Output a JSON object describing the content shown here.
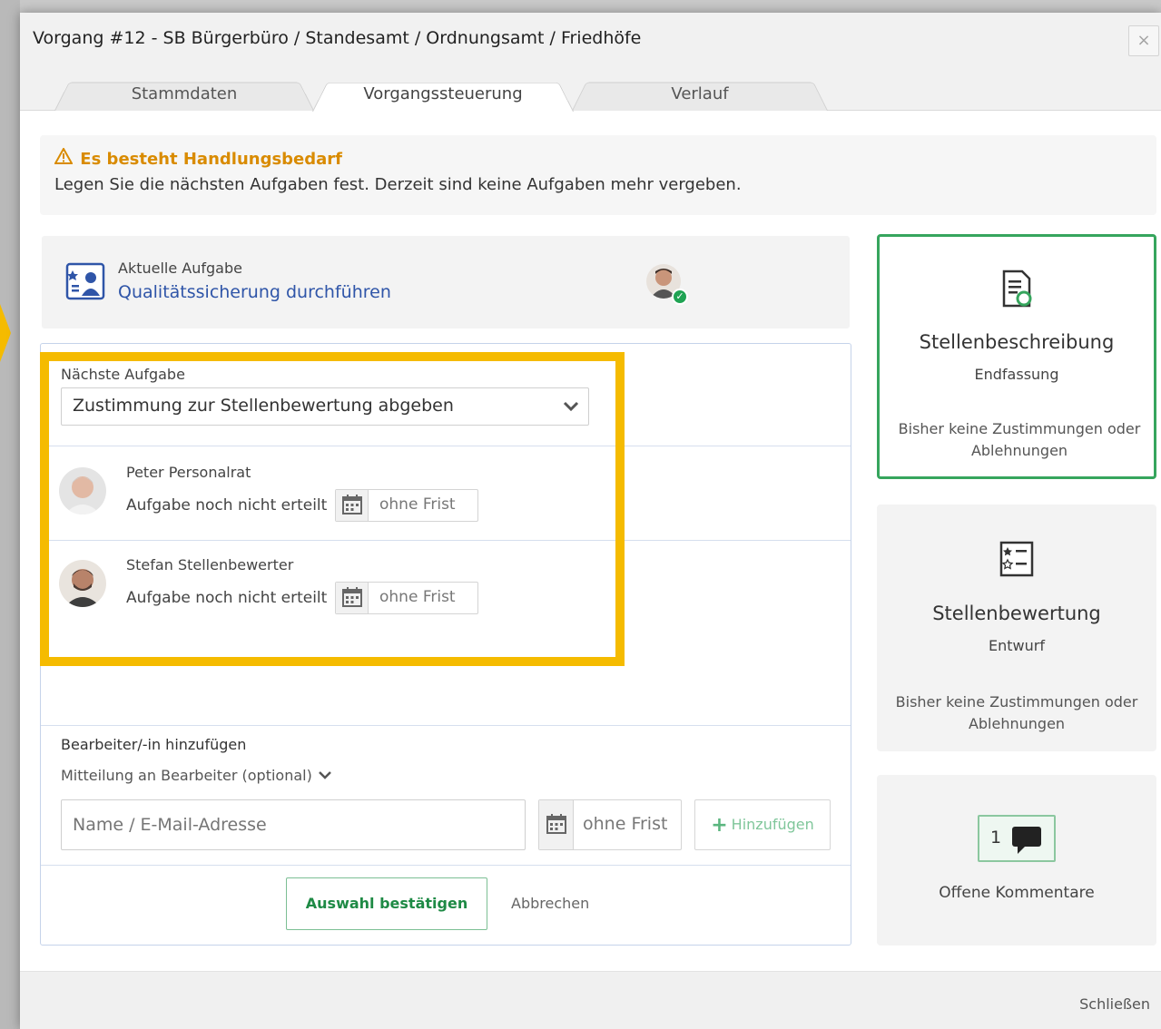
{
  "dialog": {
    "title": "Vorgang #12 - SB Bürgerbüro / Standesamt / Ordnungsamt / Friedhöfe",
    "close_icon": "×",
    "tabs": [
      {
        "label": "Stammdaten",
        "active": false
      },
      {
        "label": "Vorgangssteuerung",
        "active": true
      },
      {
        "label": "Verlauf",
        "active": false
      }
    ]
  },
  "alert": {
    "icon": "warning-icon",
    "title": "Es besteht Handlungsbedarf",
    "text": "Legen Sie die nächsten Aufgaben fest. Derzeit sind keine Aufgaben mehr vergeben."
  },
  "current_task": {
    "label": "Aktuelle Aufgabe",
    "title": "Qualitätssicherung durchführen"
  },
  "next_task": {
    "label": "Nächste Aufgabe",
    "selected": "Zustimmung zur Stellenbewertung abgeben",
    "assignees": [
      {
        "name": "Peter Personalrat",
        "status": "Aufgabe noch nicht erteilt",
        "deadline": "ohne Frist"
      },
      {
        "name": "Stefan Stellenbewerter",
        "status": "Aufgabe noch nicht erteilt",
        "deadline": "ohne Frist"
      }
    ]
  },
  "add_section": {
    "label": "Bearbeiter/-in hinzufügen",
    "message_toggle": "Mitteilung an Bearbeiter (optional)",
    "name_placeholder": "Name / E-Mail-Adresse",
    "deadline": "ohne Frist",
    "add_button": "Hinzufügen",
    "confirm_button": "Auswahl bestätigen",
    "cancel": "Abbrechen"
  },
  "cards": [
    {
      "title": "Stellenbeschreibung",
      "subtitle": "Endfassung",
      "note": "Bisher keine Zustimmungen oder Ablehnungen",
      "active": true
    },
    {
      "title": "Stellenbewertung",
      "subtitle": "Entwurf",
      "note": "Bisher keine Zustimmungen oder Ablehnungen",
      "active": false
    }
  ],
  "comments": {
    "count": "1",
    "label": "Offene Kommentare"
  },
  "footer": {
    "close": "Schließen"
  },
  "colors": {
    "accent_highlight": "#f5bb00",
    "success": "#36a55d",
    "link": "#2f55a8",
    "warning": "#d98b00"
  }
}
